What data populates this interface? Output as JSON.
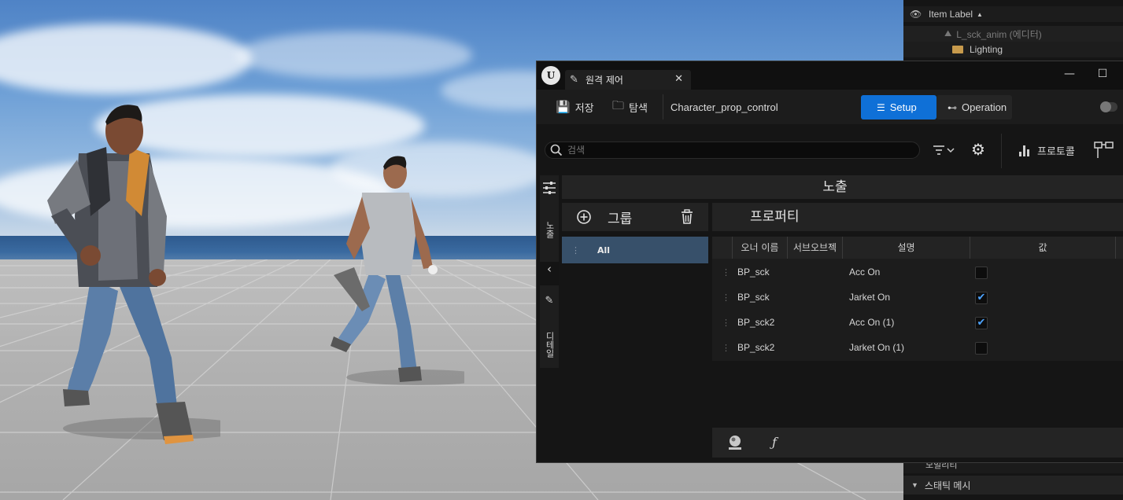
{
  "outliner": {
    "header_label": "Item Label",
    "rows": [
      {
        "label": "L_sck_anim (에디터)"
      },
      {
        "label": "Lighting"
      }
    ],
    "bottom_label": "모빌리티",
    "section_label": "스태틱 메시"
  },
  "window": {
    "tab_title": "원격 제어",
    "toolbar": {
      "save_label": "저장",
      "browse_label": "탐색",
      "preset_name": "Character_prop_control",
      "setup_label": "Setup",
      "operation_label": "Operation"
    },
    "search": {
      "placeholder": "검색"
    },
    "protocol_label": "프로토콜",
    "side_strip": {
      "expose_label": "노출",
      "details_label": "디테일"
    },
    "expose_header": "노출",
    "groups": {
      "title": "그룹",
      "items": [
        {
          "label": "All"
        }
      ]
    },
    "properties": {
      "title": "프로퍼티",
      "columns": {
        "owner": "오너 이름",
        "subobject": "서브오브젝",
        "description": "설명",
        "value": "값"
      },
      "rows": [
        {
          "owner": "BP_sck",
          "description": "Acc On",
          "checked": false
        },
        {
          "owner": "BP_sck",
          "description": "Jarket On",
          "checked": true
        },
        {
          "owner": "BP_sck2",
          "description": "Acc On (1)",
          "checked": true
        },
        {
          "owner": "BP_sck2",
          "description": "Jarket On (1)",
          "checked": false
        }
      ]
    }
  },
  "icons": {
    "check": "✔"
  },
  "colors": {
    "accent": "#0f70d7",
    "selected_group": "#37506a"
  }
}
